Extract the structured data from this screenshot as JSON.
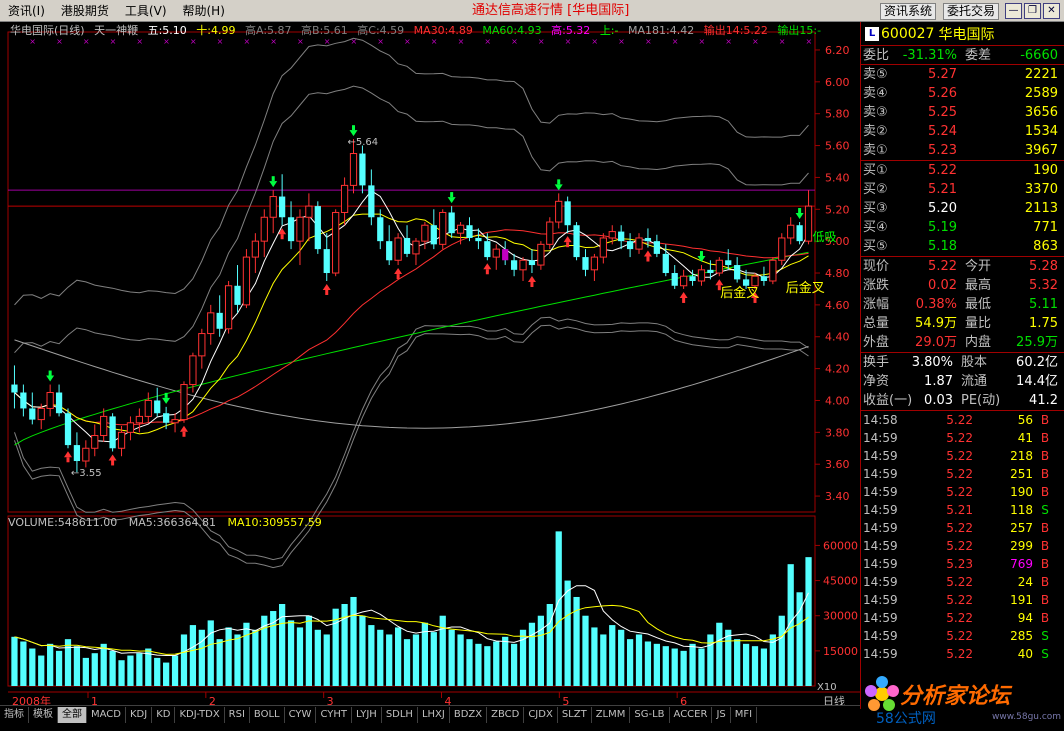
{
  "menu": [
    "资讯(I)",
    "港股期货",
    "工具(V)",
    "帮助(H)"
  ],
  "app_title": "通达信高速行情 [华电国际]",
  "sys_buttons": [
    "资讯系统",
    "委托交易"
  ],
  "chart_info": {
    "name": "华电国际(日线)",
    "indicator": "天一神鞭",
    "wu": "五:5.10",
    "shi": "十:4.99",
    "gao_a": "高A:5.87",
    "gao_b": "高B:5.61",
    "gao_c": "高C:4.59",
    "ma30": "MA30:4.89",
    "ma60": "MA60:4.93",
    "gao": "高:5.32",
    "shang": "上:-",
    "ma181": "MA181:4.42",
    "sc1": "输出14:5.22",
    "sc2": "输出15:-"
  },
  "volume_info": {
    "volume": "VOLUME:548611.00",
    "ma5": "MA5:366364.81",
    "ma10": "MA10:309557.59"
  },
  "annotations": {
    "high_label": "5.64",
    "low_label": "3.55",
    "golden_cross_1": "后金叉",
    "golden_cross_2": "后金叉",
    "low_absorb": "低吸",
    "x10": "X10"
  },
  "x_axis": {
    "year": "2008年",
    "months": [
      "1",
      "2",
      "3",
      "4",
      "5",
      "6"
    ],
    "period": "日线"
  },
  "colors": {
    "up": "#ff3232",
    "down": "#54ffff",
    "ma5": "#ffffff",
    "ma10": "#ffff00",
    "ma30": "#ff3030",
    "ma60": "#00e000",
    "ma181": "#a0a0a0",
    "band": "#808080",
    "axis": "#a00000"
  },
  "chart_data": {
    "type": "candlestick",
    "price_axis": {
      "ticks": [
        "6.20",
        "6.00",
        "5.80",
        "5.60",
        "5.40",
        "5.20",
        "5.00",
        "4.80",
        "4.60",
        "4.40",
        "4.20",
        "4.00",
        "3.80",
        "3.60",
        "3.40"
      ],
      "ylim": [
        3.3,
        6.25
      ]
    },
    "volume_axis": {
      "ticks": [
        "60000",
        "45000",
        "30000",
        "15000"
      ],
      "ylim": [
        0,
        70000
      ]
    },
    "candles": [
      [
        4.1,
        4.22,
        3.95,
        4.05
      ],
      [
        4.05,
        4.1,
        3.9,
        3.95
      ],
      [
        3.95,
        4.05,
        3.85,
        3.88
      ],
      [
        3.88,
        3.98,
        3.82,
        3.95
      ],
      [
        3.95,
        4.1,
        3.9,
        4.05
      ],
      [
        4.05,
        4.1,
        3.9,
        3.92
      ],
      [
        3.92,
        3.95,
        3.7,
        3.72
      ],
      [
        3.72,
        3.8,
        3.55,
        3.62
      ],
      [
        3.62,
        3.75,
        3.58,
        3.7
      ],
      [
        3.7,
        3.85,
        3.65,
        3.78
      ],
      [
        3.78,
        3.95,
        3.74,
        3.9
      ],
      [
        3.9,
        3.92,
        3.68,
        3.7
      ],
      [
        3.7,
        3.84,
        3.65,
        3.8
      ],
      [
        3.8,
        3.9,
        3.75,
        3.86
      ],
      [
        3.86,
        3.95,
        3.8,
        3.9
      ],
      [
        3.9,
        4.05,
        3.86,
        4.0
      ],
      [
        4.0,
        4.08,
        3.9,
        3.92
      ],
      [
        3.92,
        3.96,
        3.82,
        3.86
      ],
      [
        3.86,
        3.92,
        3.8,
        3.88
      ],
      [
        3.88,
        4.12,
        3.86,
        4.1
      ],
      [
        4.1,
        4.3,
        4.05,
        4.28
      ],
      [
        4.28,
        4.45,
        4.2,
        4.42
      ],
      [
        4.42,
        4.6,
        4.35,
        4.55
      ],
      [
        4.55,
        4.66,
        4.4,
        4.45
      ],
      [
        4.45,
        4.75,
        4.42,
        4.72
      ],
      [
        4.72,
        4.85,
        4.55,
        4.6
      ],
      [
        4.6,
        4.95,
        4.58,
        4.9
      ],
      [
        4.9,
        5.05,
        4.8,
        5.0
      ],
      [
        5.0,
        5.2,
        4.9,
        5.15
      ],
      [
        5.15,
        5.32,
        5.05,
        5.28
      ],
      [
        5.28,
        5.42,
        5.1,
        5.15
      ],
      [
        5.15,
        5.25,
        4.95,
        5.0
      ],
      [
        5.0,
        5.2,
        4.85,
        5.15
      ],
      [
        5.15,
        5.3,
        5.0,
        5.22
      ],
      [
        5.22,
        5.25,
        4.92,
        4.95
      ],
      [
        4.95,
        5.05,
        4.75,
        4.8
      ],
      [
        4.8,
        5.2,
        4.78,
        5.18
      ],
      [
        5.18,
        5.4,
        5.1,
        5.35
      ],
      [
        5.35,
        5.64,
        5.3,
        5.55
      ],
      [
        5.55,
        5.6,
        5.3,
        5.35
      ],
      [
        5.35,
        5.45,
        5.1,
        5.15
      ],
      [
        5.15,
        5.2,
        4.95,
        5.0
      ],
      [
        5.0,
        5.1,
        4.85,
        4.88
      ],
      [
        4.88,
        5.05,
        4.85,
        5.02
      ],
      [
        5.02,
        5.1,
        4.9,
        4.92
      ],
      [
        4.92,
        5.02,
        4.85,
        5.0
      ],
      [
        5.0,
        5.12,
        4.95,
        5.1
      ],
      [
        5.1,
        5.2,
        4.95,
        4.98
      ],
      [
        4.98,
        5.2,
        4.95,
        5.18
      ],
      [
        5.18,
        5.22,
        5.02,
        5.05
      ],
      [
        5.05,
        5.12,
        4.98,
        5.1
      ],
      [
        5.1,
        5.15,
        5.0,
        5.02
      ],
      [
        5.02,
        5.08,
        4.95,
        5.0
      ],
      [
        5.0,
        5.05,
        4.88,
        4.9
      ],
      [
        4.9,
        4.98,
        4.82,
        4.95
      ],
      [
        4.95,
        5.0,
        4.85,
        4.88
      ],
      [
        4.88,
        4.92,
        4.78,
        4.82
      ],
      [
        4.82,
        4.9,
        4.75,
        4.88
      ],
      [
        4.88,
        4.95,
        4.8,
        4.85
      ],
      [
        4.85,
        5.0,
        4.82,
        4.98
      ],
      [
        4.98,
        5.15,
        4.95,
        5.12
      ],
      [
        5.12,
        5.3,
        5.08,
        5.25
      ],
      [
        5.25,
        5.28,
        5.05,
        5.1
      ],
      [
        5.1,
        5.12,
        4.88,
        4.9
      ],
      [
        4.9,
        4.95,
        4.78,
        4.82
      ],
      [
        4.82,
        4.92,
        4.75,
        4.9
      ],
      [
        4.9,
        5.05,
        4.86,
        5.02
      ],
      [
        5.02,
        5.1,
        4.98,
        5.06
      ],
      [
        5.06,
        5.1,
        4.95,
        5.0
      ],
      [
        5.0,
        5.05,
        4.9,
        4.95
      ],
      [
        4.95,
        5.05,
        4.92,
        5.02
      ],
      [
        5.02,
        5.08,
        4.96,
        5.0
      ],
      [
        5.0,
        5.04,
        4.9,
        4.92
      ],
      [
        4.92,
        4.98,
        4.78,
        4.8
      ],
      [
        4.8,
        4.85,
        4.7,
        4.72
      ],
      [
        4.72,
        4.82,
        4.7,
        4.78
      ],
      [
        4.78,
        4.82,
        4.72,
        4.75
      ],
      [
        4.75,
        4.85,
        4.72,
        4.82
      ],
      [
        4.82,
        4.88,
        4.76,
        4.8
      ],
      [
        4.8,
        4.9,
        4.78,
        4.88
      ],
      [
        4.88,
        4.95,
        4.82,
        4.85
      ],
      [
        4.85,
        4.9,
        4.74,
        4.76
      ],
      [
        4.76,
        4.82,
        4.7,
        4.72
      ],
      [
        4.72,
        4.8,
        4.7,
        4.78
      ],
      [
        4.78,
        4.84,
        4.72,
        4.75
      ],
      [
        4.75,
        4.9,
        4.73,
        4.88
      ],
      [
        4.88,
        5.05,
        4.85,
        5.02
      ],
      [
        5.02,
        5.15,
        4.98,
        5.1
      ],
      [
        5.1,
        5.12,
        4.98,
        5.0
      ],
      [
        5.0,
        5.32,
        4.98,
        5.22
      ]
    ],
    "volume": [
      21000,
      19000,
      16000,
      13000,
      18000,
      15000,
      20000,
      17000,
      12000,
      14000,
      18000,
      15000,
      11000,
      13000,
      14000,
      16000,
      12000,
      10000,
      13000,
      22000,
      26000,
      24000,
      28000,
      20000,
      25000,
      22000,
      27000,
      24000,
      30000,
      32000,
      35000,
      28000,
      25000,
      30000,
      24000,
      22000,
      33000,
      35000,
      38000,
      30000,
      26000,
      24000,
      22000,
      25000,
      20000,
      22000,
      27000,
      23000,
      30000,
      24000,
      22000,
      20000,
      18000,
      17000,
      19000,
      21000,
      18000,
      24000,
      27000,
      30000,
      35000,
      66000,
      45000,
      38000,
      30000,
      25000,
      22000,
      26000,
      24000,
      20000,
      22000,
      19000,
      18000,
      17000,
      16000,
      15000,
      18000,
      16000,
      22000,
      27000,
      24000,
      20000,
      18000,
      17000,
      16000,
      22000,
      30000,
      52000,
      40000,
      55000
    ]
  },
  "quote": {
    "code": "600027",
    "name": "华电国际",
    "wb_label": "委比",
    "wb_value": "-31.31%",
    "wc_label": "委差",
    "wc_value": "-6660",
    "asks": [
      {
        "label": "卖⑤",
        "price": "5.27",
        "qty": "2221"
      },
      {
        "label": "卖④",
        "price": "5.26",
        "qty": "2589"
      },
      {
        "label": "卖③",
        "price": "5.25",
        "qty": "3656"
      },
      {
        "label": "卖②",
        "price": "5.24",
        "qty": "1534"
      },
      {
        "label": "卖①",
        "price": "5.23",
        "qty": "3967"
      }
    ],
    "bids": [
      {
        "label": "买①",
        "price": "5.22",
        "qty": "190"
      },
      {
        "label": "买②",
        "price": "5.21",
        "qty": "3370"
      },
      {
        "label": "买③",
        "price": "5.20",
        "qty": "2113"
      },
      {
        "label": "买④",
        "price": "5.19",
        "qty": "771"
      },
      {
        "label": "买⑤",
        "price": "5.18",
        "qty": "863"
      }
    ],
    "stats": [
      {
        "l1": "现价",
        "v1": "5.22",
        "l2": "今开",
        "v2": "5.28"
      },
      {
        "l1": "涨跌",
        "v1": "0.02",
        "l2": "最高",
        "v2": "5.32"
      },
      {
        "l1": "涨幅",
        "v1": "0.38%",
        "l2": "最低",
        "v2": "5.11"
      },
      {
        "l1": "总量",
        "v1": "54.9万",
        "l2": "量比",
        "v2": "1.75"
      },
      {
        "l1": "外盘",
        "v1": "29.0万",
        "l2": "内盘",
        "v2": "25.9万"
      }
    ],
    "fundamentals": [
      {
        "l1": "换手",
        "v1": "3.80%",
        "l2": "股本",
        "v2": "60.2亿"
      },
      {
        "l1": "净资",
        "v1": "1.87",
        "l2": "流通",
        "v2": "14.4亿"
      },
      {
        "l1": "收益(一)",
        "v1": "0.03",
        "l2": "PE(动)",
        "v2": "41.2"
      }
    ],
    "ticks": [
      {
        "time": "14:58",
        "price": "5.22",
        "vol": "56",
        "side": "B"
      },
      {
        "time": "14:59",
        "price": "5.22",
        "vol": "41",
        "side": "B"
      },
      {
        "time": "14:59",
        "price": "5.22",
        "vol": "218",
        "side": "B"
      },
      {
        "time": "14:59",
        "price": "5.22",
        "vol": "251",
        "side": "B"
      },
      {
        "time": "14:59",
        "price": "5.22",
        "vol": "190",
        "side": "B"
      },
      {
        "time": "14:59",
        "price": "5.21",
        "vol": "118",
        "side": "S"
      },
      {
        "time": "14:59",
        "price": "5.22",
        "vol": "257",
        "side": "B"
      },
      {
        "time": "14:59",
        "price": "5.22",
        "vol": "299",
        "side": "B"
      },
      {
        "time": "14:59",
        "price": "5.23",
        "vol": "769",
        "side": "B"
      },
      {
        "time": "14:59",
        "price": "5.22",
        "vol": "24",
        "side": "B"
      },
      {
        "time": "14:59",
        "price": "5.22",
        "vol": "191",
        "side": "B"
      },
      {
        "time": "14:59",
        "price": "5.22",
        "vol": "94",
        "side": "B"
      },
      {
        "time": "14:59",
        "price": "5.22",
        "vol": "285",
        "side": "S"
      },
      {
        "time": "14:59",
        "price": "5.22",
        "vol": "40",
        "side": "S"
      }
    ]
  },
  "tabs": [
    "指标",
    "模板",
    "全部",
    "MACD",
    "KDJ",
    "KD",
    "KDJ-TDX",
    "RSI",
    "BOLL",
    "CYW",
    "CYHT",
    "LYJH",
    "SDLH",
    "LHXJ",
    "BDZX",
    "ZBCD",
    "CJDX",
    "SLZT",
    "ZLMM",
    "SG-LB",
    "ACCER",
    "JS",
    "MFI"
  ],
  "watermark": {
    "title": "分析家论坛",
    "sub": "58公式网",
    "url": "www.58gu.com"
  }
}
